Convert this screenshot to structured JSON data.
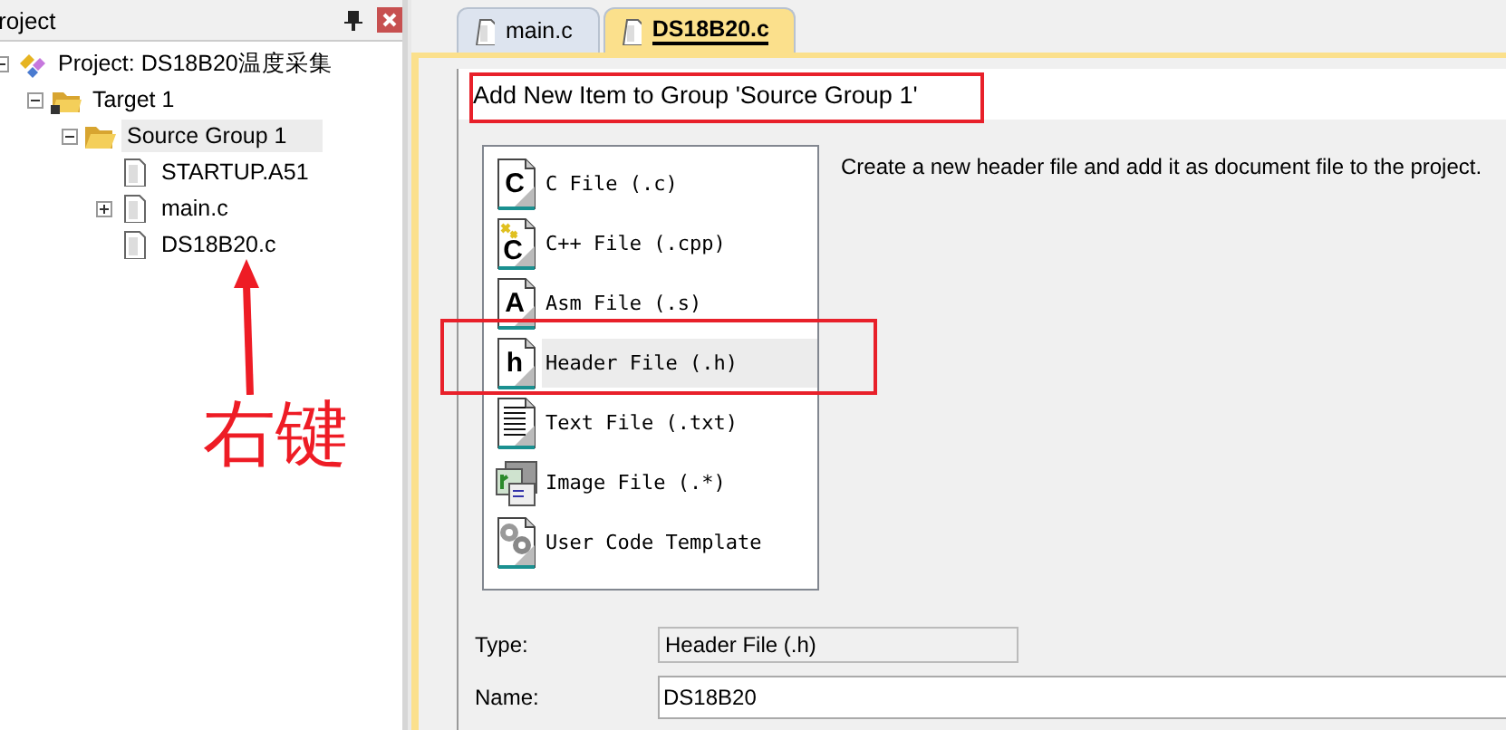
{
  "panel": {
    "title": "roject"
  },
  "tree": [
    {
      "label": "Project: DS18B20温度采集",
      "kind": "project",
      "expanded": true,
      "selected": false,
      "children": [
        {
          "label": "Target 1",
          "kind": "target",
          "expanded": true,
          "selected": false,
          "children": [
            {
              "label": "Source Group 1",
              "kind": "folder",
              "expanded": true,
              "selected": true,
              "children": [
                {
                  "label": "STARTUP.A51",
                  "kind": "file",
                  "selected": false
                },
                {
                  "label": "main.c",
                  "kind": "file",
                  "expanded": false,
                  "selected": false
                },
                {
                  "label": "DS18B20.c",
                  "kind": "file",
                  "selected": false
                }
              ]
            }
          ]
        }
      ]
    }
  ],
  "tabs": [
    {
      "label": "main.c",
      "selected": false
    },
    {
      "label": "DS18B20.c",
      "selected": true
    }
  ],
  "dialog": {
    "title": "Add New Item to Group 'Source Group 1'",
    "items": [
      {
        "label": "C File (.c)",
        "kind": "letter",
        "glyph": "C",
        "selected": false
      },
      {
        "label": "C++ File (.cpp)",
        "kind": "cpp",
        "glyph": "C",
        "selected": false
      },
      {
        "label": "Asm File (.s)",
        "kind": "letter",
        "glyph": "A",
        "selected": false
      },
      {
        "label": "Header File (.h)",
        "kind": "letter",
        "glyph": "h",
        "selected": true
      },
      {
        "label": "Text File (.txt)",
        "kind": "text",
        "selected": false
      },
      {
        "label": "Image File (.*)",
        "kind": "image",
        "selected": false
      },
      {
        "label": "User Code Template",
        "kind": "template",
        "selected": false
      }
    ],
    "description": "Create a new header file and add it as document file to the project.",
    "type_label": "Type:",
    "type_value": "Header File (.h)",
    "name_label": "Name:",
    "name_value": "DS18B20"
  },
  "annotation": {
    "label": "右键"
  }
}
